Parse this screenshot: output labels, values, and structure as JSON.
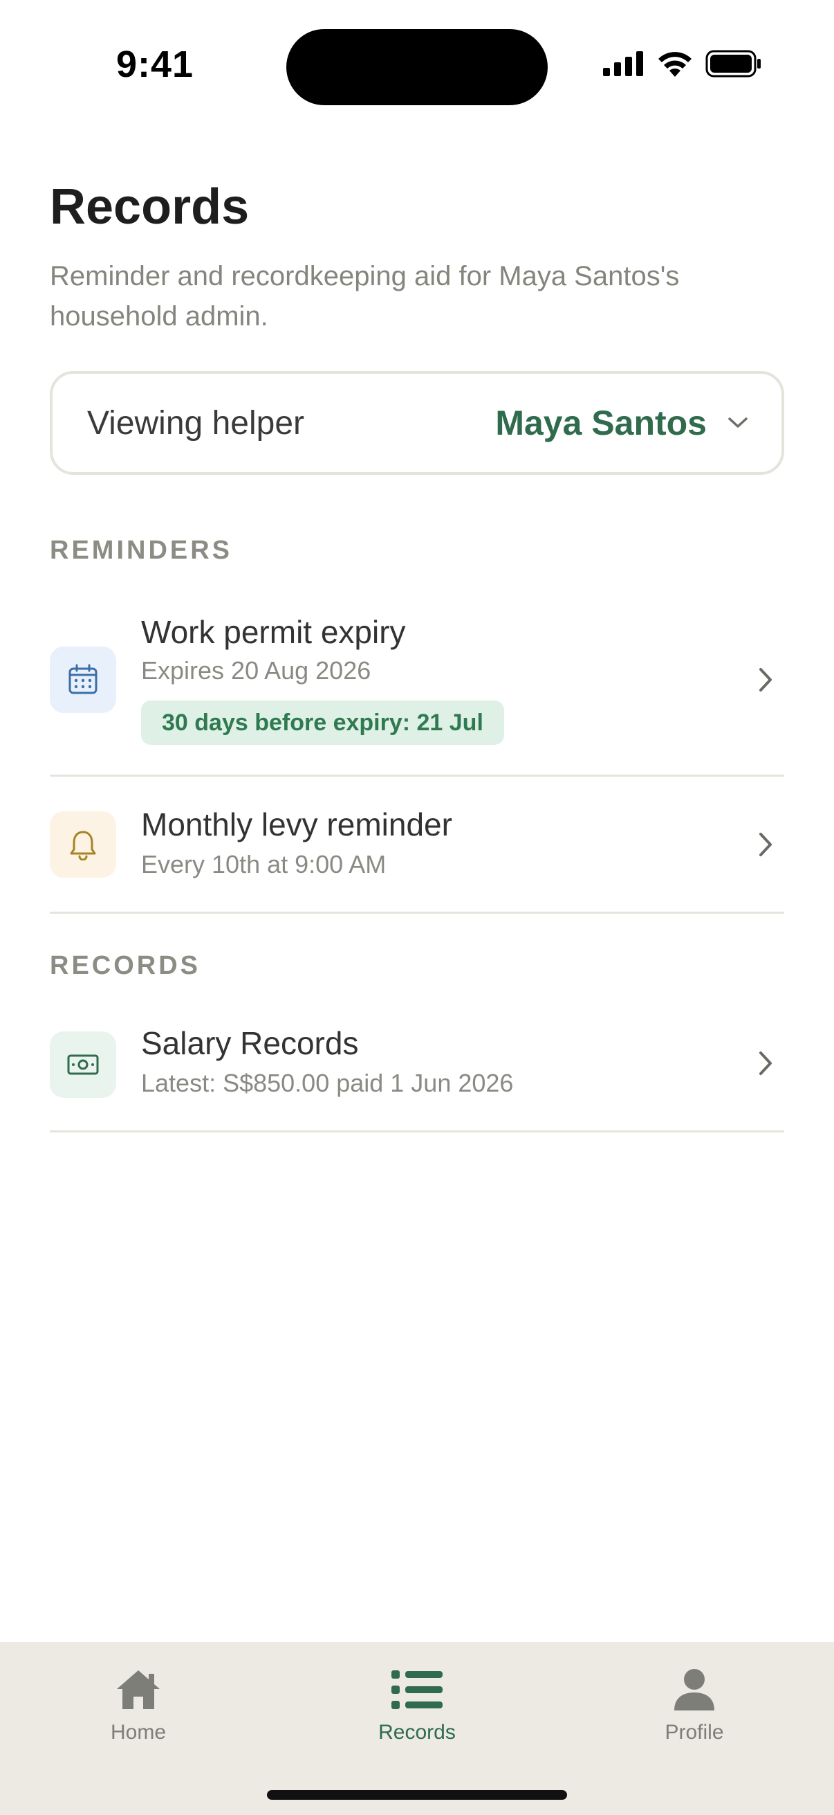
{
  "status_bar": {
    "time": "9:41"
  },
  "header": {
    "title": "Records",
    "subtitle": "Reminder and recordkeeping aid for Maya Santos's household admin."
  },
  "helper_select": {
    "label": "Viewing helper",
    "value": "Maya Santos"
  },
  "reminders": {
    "section_label": "REMINDERS",
    "items": [
      {
        "title": "Work permit expiry",
        "subtitle": "Expires 20 Aug 2026",
        "badge": "30 days before expiry: 21 Jul",
        "icon": "calendar-icon"
      },
      {
        "title": "Monthly levy reminder",
        "subtitle": "Every 10th at 9:00 AM",
        "icon": "bell-icon"
      }
    ]
  },
  "records": {
    "section_label": "RECORDS",
    "items": [
      {
        "title": "Salary Records",
        "subtitle": "Latest: S$850.00 paid 1 Jun 2026",
        "icon": "banknote-icon"
      }
    ]
  },
  "tab_bar": {
    "tabs": [
      {
        "label": "Home",
        "icon": "home-icon",
        "active": false
      },
      {
        "label": "Records",
        "icon": "list-icon",
        "active": true
      },
      {
        "label": "Profile",
        "icon": "person-icon",
        "active": false
      }
    ]
  },
  "colors": {
    "accent": "#2f6b4c",
    "badge_bg": "#dff0e6",
    "tab_bar_bg": "#edeae4",
    "calendar_icon_bg": "#e8f0fc",
    "bell_icon_bg": "#fdf3e4",
    "money_icon_bg": "#eaf4ee"
  }
}
